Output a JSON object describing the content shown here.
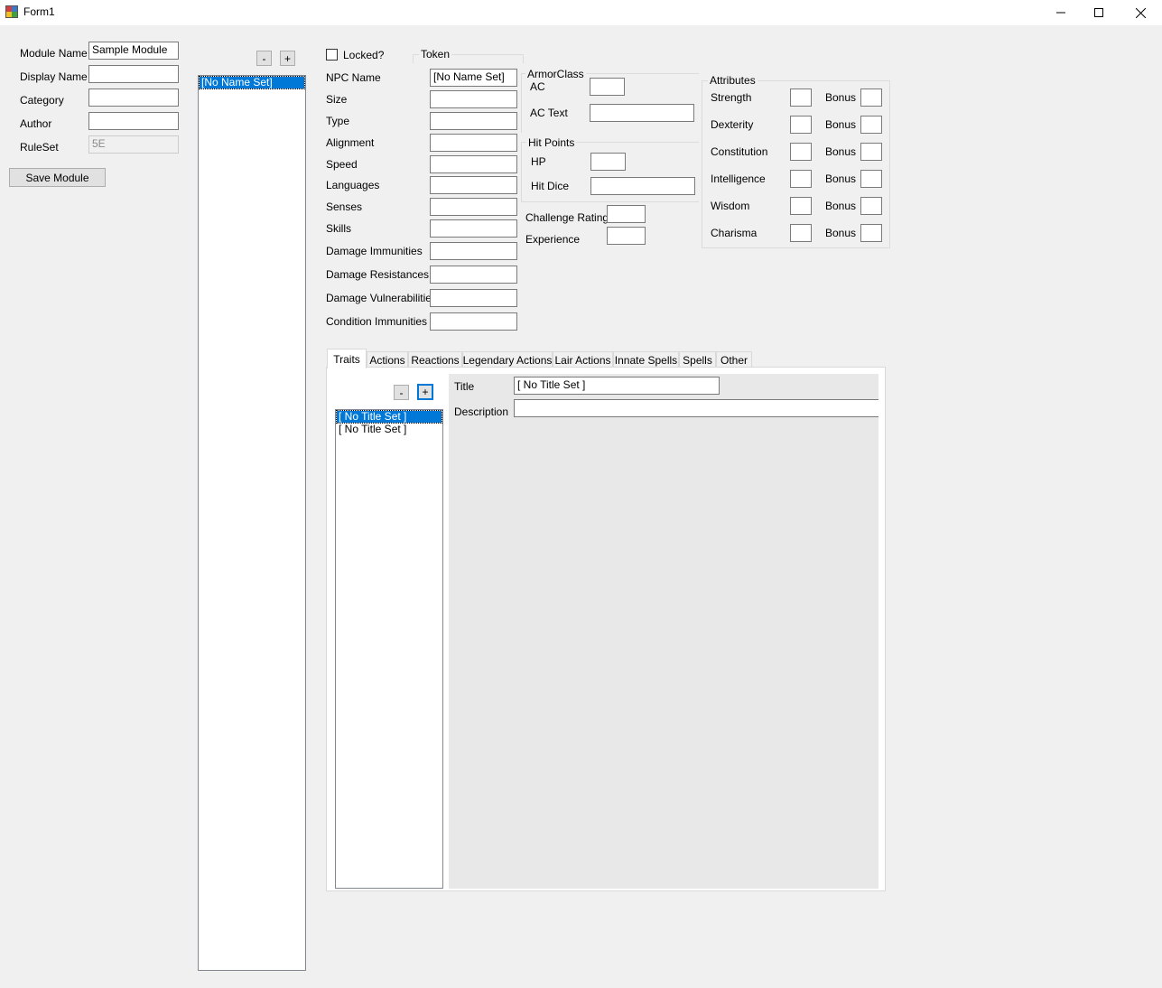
{
  "window": {
    "title": "Form1"
  },
  "module": {
    "module_name_label": "Module Name",
    "module_name_value": "Sample Module",
    "display_name_label": "Display Name",
    "display_name_value": "",
    "category_label": "Category",
    "category_value": "",
    "author_label": "Author",
    "author_value": "",
    "ruleset_label": "RuleSet",
    "ruleset_value": "5E",
    "save_button": "Save Module"
  },
  "npc_list": {
    "remove_button": "-",
    "add_button": "+",
    "items": [
      "[No Name Set]"
    ]
  },
  "npc": {
    "locked_label": "Locked?",
    "token_label": "Token",
    "fields": [
      {
        "label": "NPC Name",
        "value": "[No Name Set]"
      },
      {
        "label": "Size",
        "value": ""
      },
      {
        "label": "Type",
        "value": ""
      },
      {
        "label": "Alignment",
        "value": ""
      },
      {
        "label": "Speed",
        "value": ""
      },
      {
        "label": "Languages",
        "value": ""
      },
      {
        "label": "Senses",
        "value": ""
      },
      {
        "label": "Skills",
        "value": ""
      },
      {
        "label": "Damage Immunities",
        "value": ""
      },
      {
        "label": "Damage Resistances",
        "value": ""
      },
      {
        "label": "Damage Vulnerabilities",
        "value": ""
      },
      {
        "label": "Condition Immunities",
        "value": ""
      }
    ]
  },
  "armor_class": {
    "group_label": "ArmorClass",
    "ac_label": "AC",
    "ac_value": "",
    "ac_text_label": "AC Text",
    "ac_text_value": ""
  },
  "hit_points": {
    "group_label": "Hit Points",
    "hp_label": "HP",
    "hp_value": "",
    "hit_dice_label": "Hit Dice",
    "hit_dice_value": ""
  },
  "challenge": {
    "challenge_rating_label": "Challenge Rating",
    "challenge_rating_value": "",
    "experience_label": "Experience",
    "experience_value": ""
  },
  "attributes": {
    "group_label": "Attributes",
    "bonus_label": "Bonus",
    "items": [
      {
        "label": "Strength",
        "value": "",
        "bonus": ""
      },
      {
        "label": "Dexterity",
        "value": "",
        "bonus": ""
      },
      {
        "label": "Constitution",
        "value": "",
        "bonus": ""
      },
      {
        "label": "Intelligence",
        "value": "",
        "bonus": ""
      },
      {
        "label": "Wisdom",
        "value": "",
        "bonus": ""
      },
      {
        "label": "Charisma",
        "value": "",
        "bonus": ""
      }
    ]
  },
  "tabs": [
    "Traits",
    "Actions",
    "Reactions",
    "Legendary Actions",
    "Lair Actions",
    "Innate Spells",
    "Spells",
    "Other"
  ],
  "traits": {
    "remove_button": "-",
    "add_button": "+",
    "items": [
      "[ No Title Set ]",
      "[ No Title Set ]"
    ],
    "title_label": "Title",
    "title_value": "[ No Title Set ]",
    "description_label": "Description",
    "description_value": ""
  }
}
